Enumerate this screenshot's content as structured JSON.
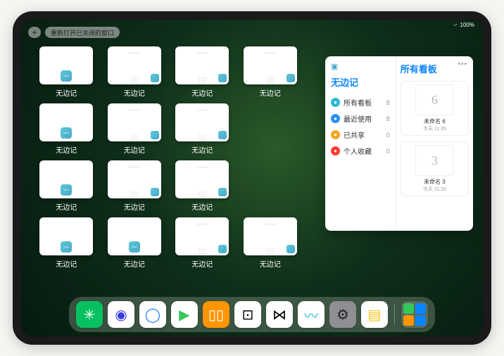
{
  "status": {
    "wifi": "wifi-icon",
    "battery": "100%"
  },
  "topbar": {
    "plus_label": "+",
    "reopen_label": "重新打开已关闭的窗口"
  },
  "window_label": "无边记",
  "panel": {
    "title": "无边记",
    "right_title": "所有看板",
    "items": [
      {
        "label": "所有看板",
        "count": 8,
        "color": "#2dbad3"
      },
      {
        "label": "最近使用",
        "count": 8,
        "color": "#2b8ff5"
      },
      {
        "label": "已共享",
        "count": 0,
        "color": "#f5a623"
      },
      {
        "label": "个人收藏",
        "count": 0,
        "color": "#ff3b30"
      }
    ],
    "boards": [
      {
        "glyph": "6",
        "name": "未命名 6",
        "time": "今天 11:35"
      },
      {
        "glyph": "3",
        "name": "未命名 3",
        "time": "今天 11:20"
      }
    ]
  },
  "dock": [
    {
      "name": "wechat",
      "bg": "#07c160",
      "glyph": "✳",
      "fg": "#fff"
    },
    {
      "name": "quark-hd",
      "bg": "#ffffff",
      "glyph": "◉",
      "fg": "#3a3ae6"
    },
    {
      "name": "quark",
      "bg": "#ffffff",
      "glyph": "◯",
      "fg": "#2a7dff"
    },
    {
      "name": "media",
      "bg": "#ffffff",
      "glyph": "▶",
      "fg": "#34c759"
    },
    {
      "name": "books",
      "bg": "#ff9500",
      "glyph": "▯▯",
      "fg": "#fff"
    },
    {
      "name": "dice",
      "bg": "#ffffff",
      "glyph": "⊡",
      "fg": "#000"
    },
    {
      "name": "connect",
      "bg": "#ffffff",
      "glyph": "⋈",
      "fg": "#000"
    },
    {
      "name": "freeform",
      "bg": "#ffffff",
      "glyph": "〰",
      "fg": "#2dbad3"
    },
    {
      "name": "settings",
      "bg": "#8e8e93",
      "glyph": "⚙",
      "fg": "#222"
    },
    {
      "name": "notes",
      "bg": "#fff",
      "glyph": "▤",
      "fg": "#f5c518"
    },
    {
      "name": "recents-folder",
      "bg": "transparent"
    }
  ]
}
